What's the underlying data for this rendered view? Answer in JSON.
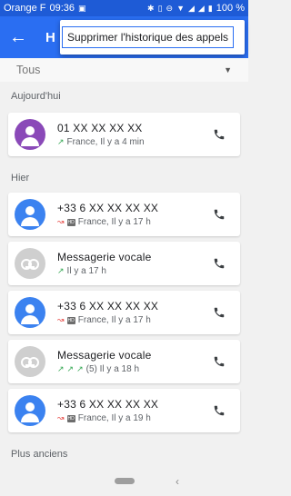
{
  "status_bar": {
    "carrier": "Orange F",
    "time": "09:36",
    "battery": "100 %"
  },
  "app_bar": {
    "title_partial": "H"
  },
  "menu": {
    "items": [
      "Supprimer l'historique des appels"
    ]
  },
  "filter": {
    "selected": "Tous"
  },
  "sections": {
    "today": "Aujourd'hui",
    "yesterday": "Hier",
    "older": "Plus anciens"
  },
  "calls": [
    {
      "name": "01 XX XX XX XX",
      "meta": "France, Il y a 4 min",
      "avatar": "contact",
      "color": "#8a49b8",
      "type": "incoming",
      "hd": false
    },
    {
      "name": "+33 6 XX XX XX XX",
      "meta": "France, Il y a 17 h",
      "avatar": "contact",
      "color": "#3b82f0",
      "type": "missed",
      "hd": true
    },
    {
      "name": "Messagerie vocale",
      "meta": "Il y a 17 h",
      "avatar": "voicemail",
      "color": "#cfcfcf",
      "type": "incoming",
      "hd": false
    },
    {
      "name": "+33 6 XX XX XX XX",
      "meta": "France, Il y a 17 h",
      "avatar": "contact",
      "color": "#3b82f0",
      "type": "missed",
      "hd": true
    },
    {
      "name": "Messagerie vocale",
      "meta": "(5) Il y a 18 h",
      "avatar": "voicemail",
      "color": "#cfcfcf",
      "type": "incoming-multi",
      "hd": false
    },
    {
      "name": "+33 6 XX XX XX XX",
      "meta": "France, Il y a 19 h",
      "avatar": "contact",
      "color": "#3b82f0",
      "type": "missed",
      "hd": true
    }
  ],
  "icons": {
    "back": "arrow-back-icon",
    "dropdown": "caret-down-icon",
    "call": "phone-icon",
    "nav_home": "home-pill-icon",
    "nav_back": "chevron-left-icon"
  }
}
